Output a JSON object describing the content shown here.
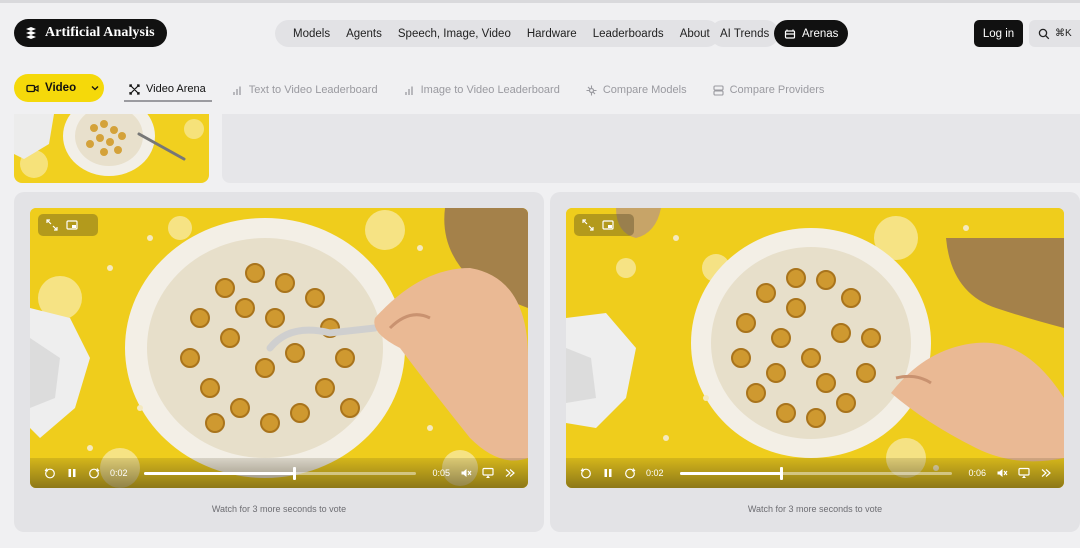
{
  "header": {
    "logo_text": "Artificial Analysis",
    "nav_items": [
      "Models",
      "Agents",
      "Speech, Image, Video",
      "Hardware",
      "Leaderboards",
      "About"
    ],
    "ai_trends": "AI Trends",
    "arenas": "Arenas",
    "login": "Log in",
    "search_shortcut": "⌘K"
  },
  "subnav": {
    "modality": "Video",
    "tabs": [
      {
        "label": "Video Arena",
        "icon": "swords-icon",
        "active": true
      },
      {
        "label": "Text to Video Leaderboard",
        "icon": "bar-chart-icon",
        "active": false
      },
      {
        "label": "Image to Video Leaderboard",
        "icon": "bar-chart-icon",
        "active": false
      },
      {
        "label": "Compare Models",
        "icon": "compare-icon",
        "active": false
      },
      {
        "label": "Compare Providers",
        "icon": "server-icon",
        "active": false
      }
    ]
  },
  "arena": {
    "videos": [
      {
        "current_time": "0:02",
        "duration": "0:05",
        "progress": 0.55,
        "vote_text": "Watch for 3 more seconds to vote"
      },
      {
        "current_time": "0:02",
        "duration": "0:06",
        "progress": 0.37,
        "vote_text": "Watch for 3 more seconds to vote"
      }
    ]
  },
  "colors": {
    "accent_yellow": "#f5d90a",
    "dark": "#111111",
    "page_bg": "#f0f0f2"
  }
}
